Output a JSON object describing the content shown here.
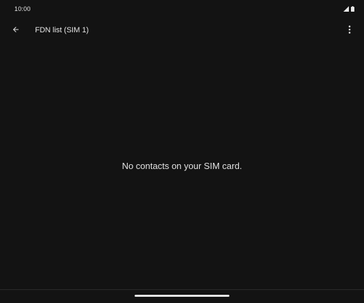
{
  "status_bar": {
    "time": "10:00",
    "icons": [
      "signal-icon",
      "battery-icon"
    ]
  },
  "app_bar": {
    "back_icon": "arrow-back-icon",
    "title": "FDN list (SIM 1)",
    "overflow_icon": "more-vert-icon"
  },
  "content": {
    "empty_message": "No contacts on your SIM card."
  },
  "colors": {
    "background": "#131313",
    "text": "#e6e6e6"
  }
}
